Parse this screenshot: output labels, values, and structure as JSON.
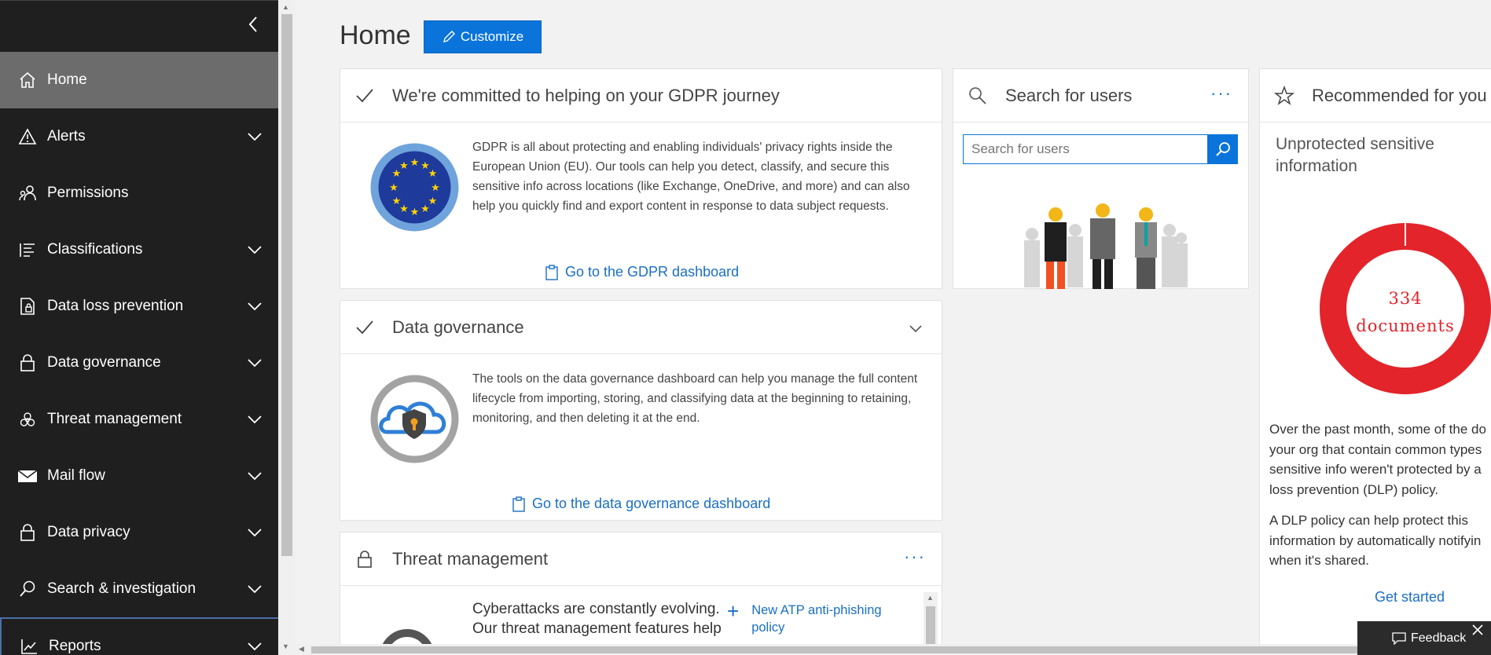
{
  "sidebar": {
    "collapse_icon": "chevron-left-icon",
    "items": [
      {
        "label": "Home",
        "icon": "home-icon",
        "expandable": false,
        "active": true
      },
      {
        "label": "Alerts",
        "icon": "warning-icon",
        "expandable": true
      },
      {
        "label": "Permissions",
        "icon": "people-icon",
        "expandable": false
      },
      {
        "label": "Classifications",
        "icon": "list-icon",
        "expandable": true
      },
      {
        "label": "Data loss prevention",
        "icon": "lock-document-icon",
        "expandable": true
      },
      {
        "label": "Data governance",
        "icon": "lock-icon",
        "expandable": true
      },
      {
        "label": "Threat management",
        "icon": "biohazard-icon",
        "expandable": true
      },
      {
        "label": "Mail flow",
        "icon": "mail-icon",
        "expandable": true
      },
      {
        "label": "Data privacy",
        "icon": "lock-icon",
        "expandable": true
      },
      {
        "label": "Search & investigation",
        "icon": "search-icon",
        "expandable": true
      },
      {
        "label": "Reports",
        "icon": "chart-icon",
        "expandable": true
      }
    ]
  },
  "header": {
    "title": "Home",
    "customize_label": "Customize"
  },
  "gdpr_card": {
    "title": "We're committed to helping on your GDPR journey",
    "body": "GDPR is all about protecting and enabling individuals' privacy rights inside the European Union (EU). Our tools can help you detect, classify, and secure this sensitive info across locations (like Exchange, OneDrive, and more) and can also help you quickly find and export content in response to data subject requests.",
    "link": "Go to the GDPR dashboard"
  },
  "governance_card": {
    "title": "Data governance",
    "body": "The tools on the data governance dashboard can help you manage the full content lifecycle from importing, storing, and classifying data at the beginning to retaining, monitoring, and then deleting it at the end.",
    "link": "Go to the data governance dashboard"
  },
  "threat_card": {
    "title": "Threat management",
    "body_lines": [
      "Cyberattacks are constantly evolving.",
      "Our threat management features help"
    ],
    "action_label": "New ATP anti-phishing policy"
  },
  "search_card": {
    "title": "Search for users",
    "placeholder": "Search for users"
  },
  "recommended_card": {
    "title": "Recommended for you",
    "subtitle": "Unprotected sensitive information",
    "count_number": "334",
    "count_unit": "documents",
    "body_lines_1": [
      "Over the past month, some of the do",
      "your org that contain common types",
      "sensitive info weren't protected by a",
      "loss prevention (DLP) policy."
    ],
    "body_lines_2": [
      "A DLP policy can help protect this",
      "information by automatically notifyin",
      "when it's shared."
    ],
    "action": "Get started",
    "accent_color": "#e3242b"
  },
  "feedback": {
    "label": "Feedback"
  },
  "colors": {
    "sidebar_bg": "#1f1f1f",
    "active_bg": "#6c6c6c",
    "accent": "#0a74da",
    "link": "#1a6fc4"
  }
}
